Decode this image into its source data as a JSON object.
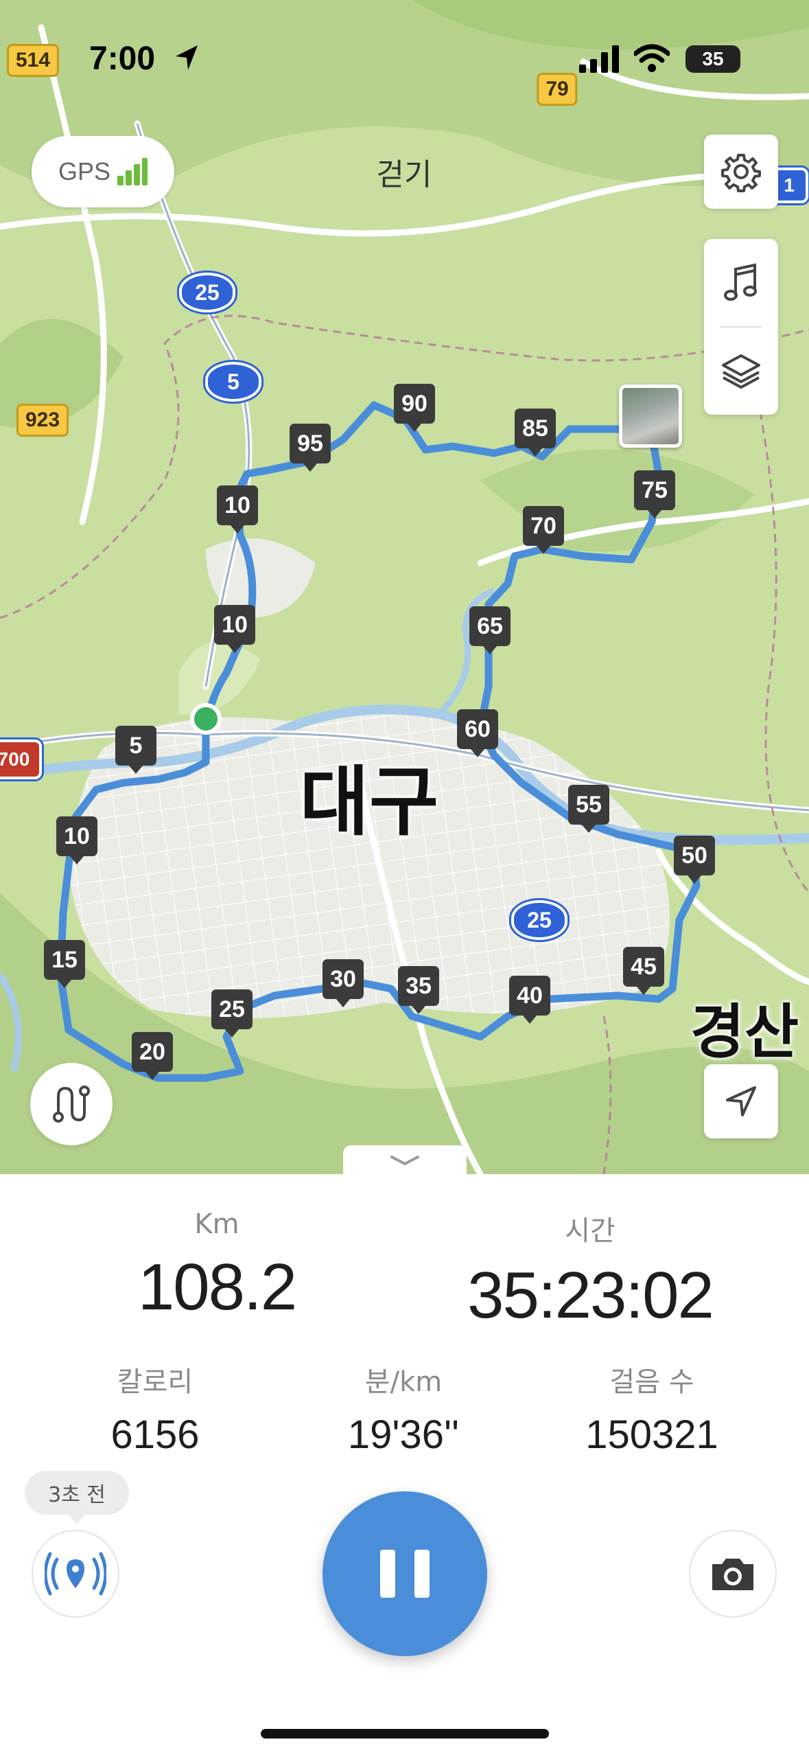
{
  "status_bar": {
    "time": "7:00",
    "battery": "35"
  },
  "map": {
    "mode_title": "걷기",
    "gps_label": "GPS",
    "city_labels": [
      "대구",
      "경산"
    ],
    "highway_badges": [
      "514",
      "79",
      "923",
      "25",
      "5",
      "25",
      "700",
      "1"
    ],
    "km_markers": [
      "5",
      "10",
      "10",
      "10",
      "15",
      "20",
      "25",
      "30",
      "35",
      "40",
      "45",
      "50",
      "55",
      "60",
      "65",
      "70",
      "75",
      "85",
      "90",
      "95"
    ],
    "route_color": "#4a8ed9",
    "start_marker_color": "#3cb061"
  },
  "stats": {
    "distance_label": "Km",
    "distance_value": "108.2",
    "time_label": "시간",
    "time_value": "35:23:02",
    "calories_label": "칼로리",
    "calories_value": "6156",
    "pace_label": "분/km",
    "pace_value": "19'36''",
    "steps_label": "걸음 수",
    "steps_value": "150321"
  },
  "controls": {
    "last_update_tooltip": "3초 전",
    "pause_button_color": "#4a8ed9"
  }
}
